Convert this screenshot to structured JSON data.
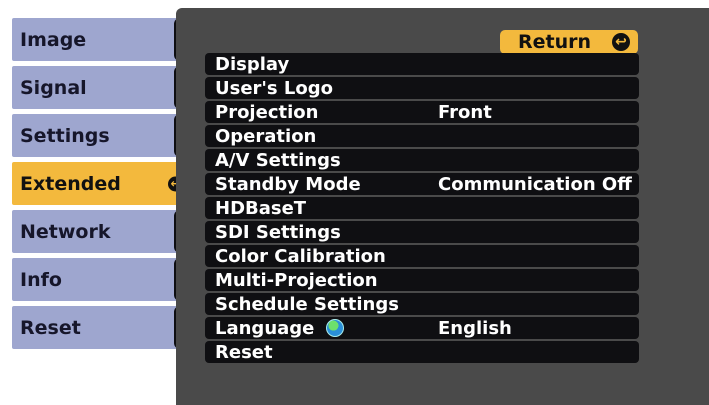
{
  "left_menu": {
    "tabs": [
      {
        "label": "Image",
        "active": false
      },
      {
        "label": "Signal",
        "active": false
      },
      {
        "label": "Settings",
        "active": false
      },
      {
        "label": "Extended",
        "active": true
      },
      {
        "label": "Network",
        "active": false
      },
      {
        "label": "Info",
        "active": false
      },
      {
        "label": "Reset",
        "active": false
      }
    ]
  },
  "panel": {
    "return_label": "Return",
    "items": [
      {
        "label": "Display",
        "value": ""
      },
      {
        "label": "User's Logo",
        "value": ""
      },
      {
        "label": "Projection",
        "value": "Front"
      },
      {
        "label": "Operation",
        "value": ""
      },
      {
        "label": "A/V Settings",
        "value": ""
      },
      {
        "label": "Standby Mode",
        "value": "Communication Off"
      },
      {
        "label": "HDBaseT",
        "value": ""
      },
      {
        "label": "SDI Settings",
        "value": ""
      },
      {
        "label": "Color Calibration",
        "value": ""
      },
      {
        "label": "Multi-Projection",
        "value": ""
      },
      {
        "label": "Schedule Settings",
        "value": ""
      },
      {
        "label": "Language",
        "value": "English",
        "icon": "globe-icon"
      },
      {
        "label": "Reset",
        "value": ""
      }
    ]
  },
  "colors": {
    "tab_bg": "#9ea6cf",
    "active_accent": "#f3b93d",
    "panel_bg": "#4a4a4a",
    "row_bg": "#0f0f12"
  }
}
